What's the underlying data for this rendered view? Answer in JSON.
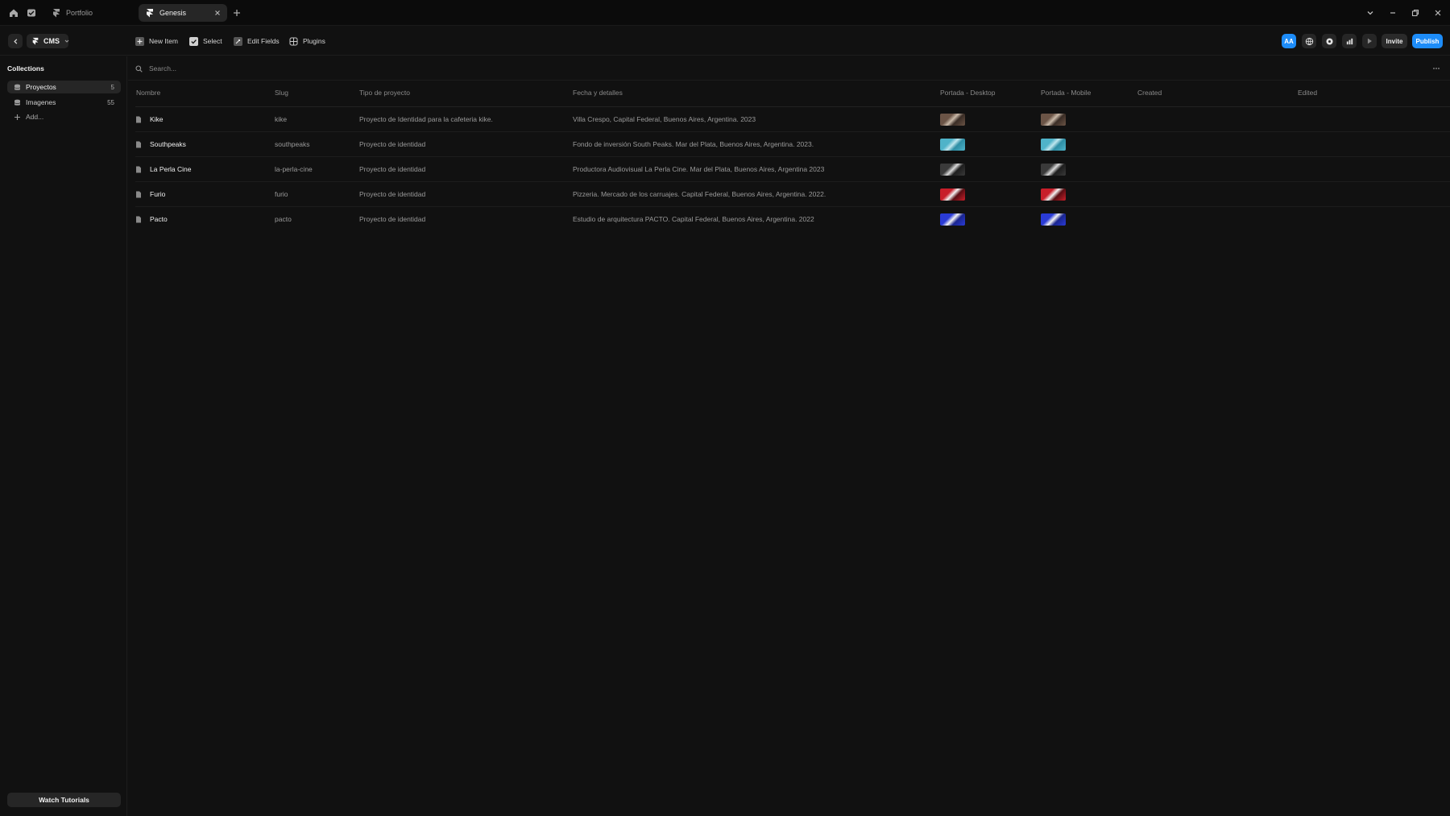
{
  "titlebar": {
    "tabs": [
      {
        "label": "Portfolio",
        "active": false
      },
      {
        "label": "Genesis",
        "active": true
      }
    ]
  },
  "toolbar": {
    "section_label": "CMS",
    "tools": [
      {
        "label": "New Item",
        "icon": "plus-icon"
      },
      {
        "label": "Select",
        "icon": "checkbox-icon"
      },
      {
        "label": "Edit Fields",
        "icon": "edit-fields-icon"
      },
      {
        "label": "Plugins",
        "icon": "grid-icon"
      }
    ],
    "aa_label": "AA",
    "invite_label": "Invite",
    "publish_label": "Publish",
    "accent_color": "#1d8cf8"
  },
  "sidebar": {
    "title": "Collections",
    "items": [
      {
        "label": "Proyectos",
        "count": "5",
        "active": true
      },
      {
        "label": "Imagenes",
        "count": "55",
        "active": false
      }
    ],
    "add_label": "Add...",
    "watch_label": "Watch Tutorials"
  },
  "search": {
    "placeholder": "Search..."
  },
  "table": {
    "columns": [
      "Nombre",
      "Slug",
      "Tipo de proyecto",
      "Fecha y detalles",
      "Portada - Desktop",
      "Portada - Mobile",
      "Created",
      "Edited"
    ],
    "rows": [
      {
        "nombre": "Kike",
        "slug": "kike",
        "tipo": "Proyecto de Identidad para la cafeteria kike.",
        "fecha": "Villa Crespo, Capital Federal, Buenos Aires, Argentina. 2023",
        "thumb_colors": [
          "#6b5446",
          "#c9b9a8",
          "#3a2d26"
        ]
      },
      {
        "nombre": "Southpeaks",
        "slug": "southpeaks",
        "tipo": "Proyecto de identidad",
        "fecha": "Fondo de inversión South Peaks. Mar del Plata, Buenos Aires, Argentina. 2023.",
        "thumb_colors": [
          "#4fb3c9",
          "#bfe6ee",
          "#2e8ea5"
        ]
      },
      {
        "nombre": "La Perla Cine",
        "slug": "la-perla-cine",
        "tipo": "Proyecto de identidad",
        "fecha": "Productora Audiovisual La Perla Cine. Mar del Plata, Buenos Aires, Argentina 2023",
        "thumb_colors": [
          "#3a3a3a",
          "#d9d9d9",
          "#1e1e1e"
        ]
      },
      {
        "nombre": "Furio",
        "slug": "furio",
        "tipo": "Proyecto de identidad",
        "fecha": "Pizzeria. Mercado de los carruajes. Capital Federal, Buenos Aires, Argentina. 2022.",
        "thumb_colors": [
          "#c81e2a",
          "#f2f2f2",
          "#5a0d12"
        ]
      },
      {
        "nombre": "Pacto",
        "slug": "pacto",
        "tipo": "Proyecto de identidad",
        "fecha": "Estudio de arquitectura PACTO. Capital Federal, Buenos Aires, Argentina. 2022",
        "thumb_colors": [
          "#2a3bd6",
          "#f4f4f4",
          "#1a2590"
        ]
      }
    ]
  }
}
